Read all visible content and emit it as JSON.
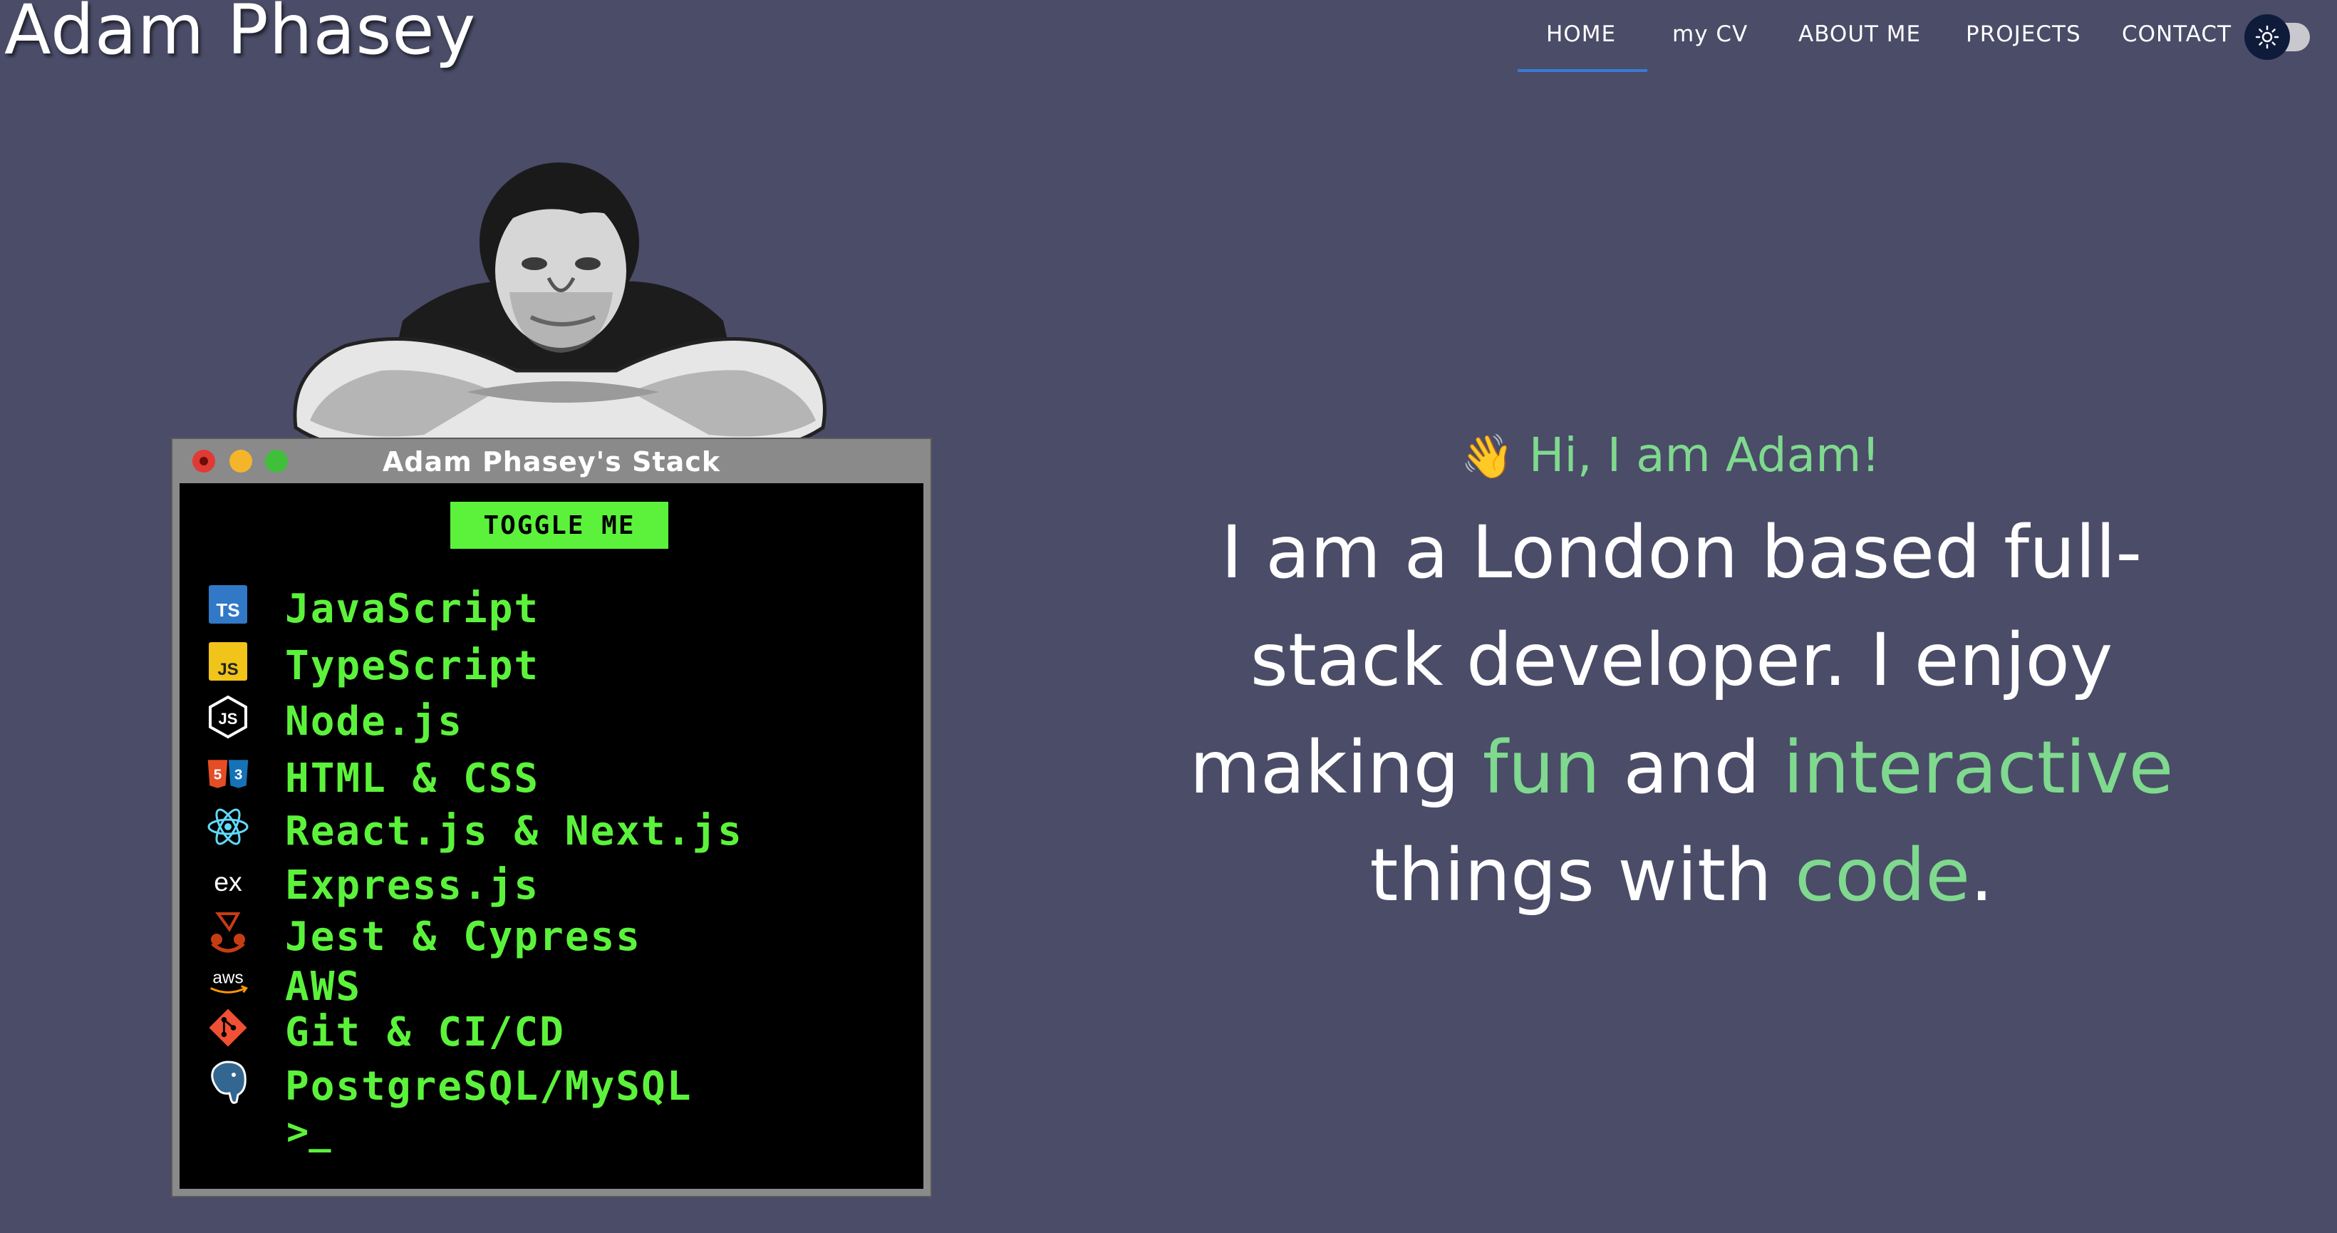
{
  "header": {
    "site_title": "Adam Phasey",
    "nav": [
      {
        "label": "HOME",
        "active": true
      },
      {
        "label": "my CV"
      },
      {
        "label": "ABOUT ME"
      },
      {
        "label": "PROJECTS"
      },
      {
        "label": "CONTACT"
      }
    ],
    "theme_toggle_icon": "sun-icon"
  },
  "terminal": {
    "title": "Adam Phasey's Stack",
    "toggle_label": "TOGGLE ME",
    "stack": [
      {
        "label": "JavaScript",
        "icon": "typescript-icon"
      },
      {
        "label": "TypeScript",
        "icon": "javascript-icon"
      },
      {
        "label": "Node.js",
        "icon": "nodejs-icon"
      },
      {
        "label": "HTML & CSS",
        "icon": "html-css-icon"
      },
      {
        "label": "React.js & Next.js",
        "icon": "react-icon"
      },
      {
        "label": "Express.js",
        "icon": "express-icon"
      },
      {
        "label": "Jest & Cypress",
        "icon": "jest-icon"
      },
      {
        "label": "AWS",
        "icon": "aws-icon"
      },
      {
        "label": "Git & CI/CD",
        "icon": "git-icon"
      },
      {
        "label": "PostgreSQL/MySQL",
        "icon": "postgresql-icon"
      }
    ],
    "prompt": ">_"
  },
  "intro": {
    "wave": "👋",
    "greeting": "Hi, I am Adam!",
    "line_start": "I am a London based full-stack developer. I enjoy making ",
    "hl_fun": "fun",
    "and": " and ",
    "hl_interactive": "interactive",
    "things_with": " things with ",
    "hl_code": "code",
    "period": "."
  },
  "colors": {
    "background": "#4a4c68",
    "accent_green": "#7fd98e",
    "terminal_green": "#5cf23c",
    "nav_underline": "#3a7bd5"
  }
}
